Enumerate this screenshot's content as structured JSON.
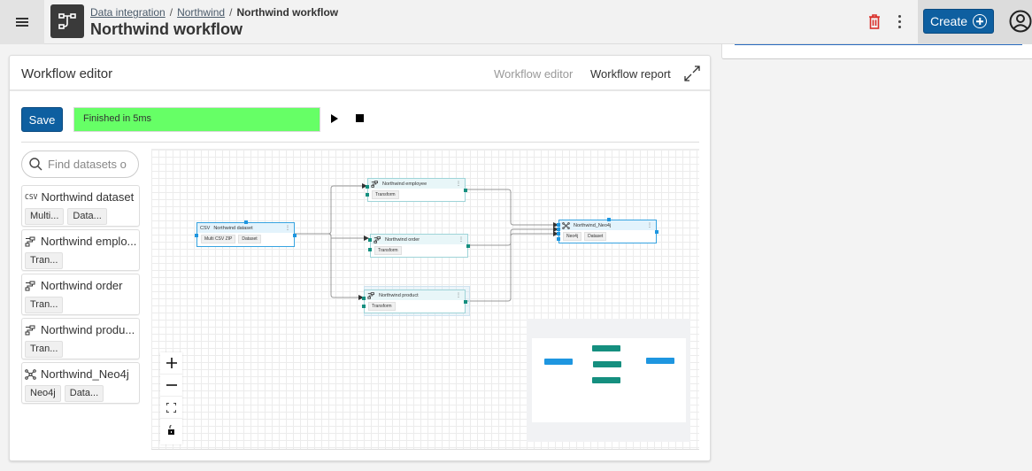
{
  "header": {
    "breadcrumb": [
      {
        "label": "Data integration"
      },
      {
        "label": "Northwind"
      }
    ],
    "breadcrumb_current": "Northwind workflow",
    "title": "Northwind workflow",
    "create_label": "Create",
    "icons": {
      "menu": "hamburger-icon",
      "logo": "workflow-icon",
      "delete": "trash-icon",
      "more": "kebab-icon",
      "create": "plus-circle-icon",
      "user": "user-avatar-icon"
    },
    "colors": {
      "primary": "#0e5fa0",
      "danger": "#d9302b"
    }
  },
  "editor": {
    "title": "Workflow editor",
    "tabs": [
      {
        "label": "Workflow editor",
        "active": false
      },
      {
        "label": "Workflow report",
        "active": true
      }
    ],
    "save_label": "Save",
    "status_text": "Finished in 5ms",
    "status_color": "#66ff66",
    "search_placeholder": "Find datasets o",
    "datasets": [
      {
        "icon": "csv-icon",
        "name": "Northwind dataset",
        "tags": [
          "Multi...",
          "Data..."
        ]
      },
      {
        "icon": "transform-icon",
        "name": "Northwind emplo...",
        "tags": [
          "Tran..."
        ]
      },
      {
        "icon": "transform-icon",
        "name": "Northwind order",
        "tags": [
          "Tran..."
        ]
      },
      {
        "icon": "transform-icon",
        "name": "Northwind produ...",
        "tags": [
          "Tran..."
        ]
      },
      {
        "icon": "graph-icon",
        "name": "Northwind_Neo4j",
        "tags": [
          "Neo4j",
          "Data..."
        ]
      }
    ],
    "nodes": [
      {
        "id": "dataset",
        "icon": "csv-icon",
        "label": "Northwind dataset",
        "tags": [
          "Multi CSV ZIP",
          "Dataset"
        ]
      },
      {
        "id": "employee",
        "icon": "transform-icon",
        "label": "Northwind employee",
        "tags": [
          "Transform"
        ]
      },
      {
        "id": "order",
        "icon": "transform-icon",
        "label": "Northwind order",
        "tags": [
          "Transform"
        ]
      },
      {
        "id": "product",
        "icon": "transform-icon",
        "label": "Northwind product",
        "tags": [
          "Transform"
        ]
      },
      {
        "id": "neo4j",
        "icon": "graph-icon",
        "label": "Northwind_Neo4j",
        "tags": [
          "Neo4j",
          "Dataset"
        ]
      }
    ],
    "edges": [
      {
        "from": "dataset",
        "to": "employee"
      },
      {
        "from": "dataset",
        "to": "order"
      },
      {
        "from": "dataset",
        "to": "product"
      },
      {
        "from": "employee",
        "to": "neo4j"
      },
      {
        "from": "order",
        "to": "neo4j"
      },
      {
        "from": "product",
        "to": "neo4j"
      }
    ],
    "zoom_controls": [
      "zoom-in",
      "zoom-out",
      "fit-view",
      "lock"
    ],
    "csv_glyph": "CSV"
  }
}
